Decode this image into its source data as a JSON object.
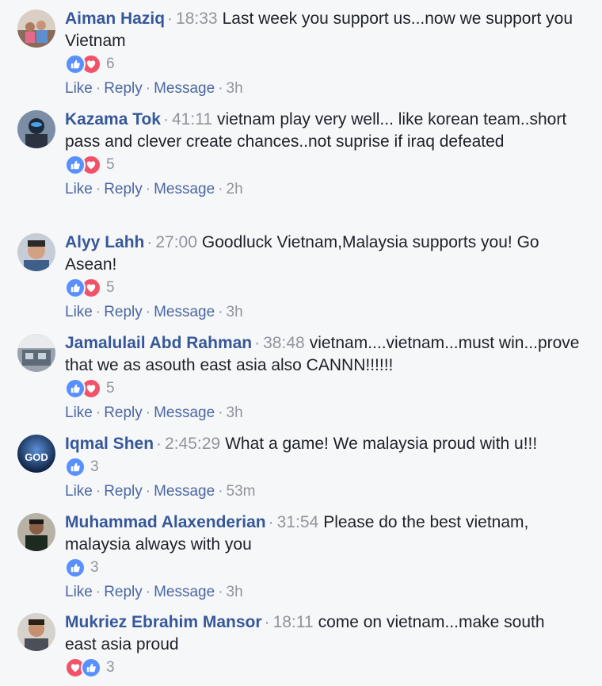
{
  "actions": {
    "like": "Like",
    "reply": "Reply",
    "message": "Message"
  },
  "colors": {
    "link": "#365899",
    "meta": "#90949c",
    "like": "#5890ff",
    "love": "#f25268",
    "background": "#f6f7f9"
  },
  "comments": [
    {
      "author": "Aiman Haziq",
      "timestamp": "18:33",
      "text": "Last week you support us...now we support you Vietnam",
      "reactions": [
        "like-icon",
        "love-icon"
      ],
      "count": "6",
      "age": "3h"
    },
    {
      "author": "Kazama Tok",
      "timestamp": "41:11",
      "text": "vietnam play very well... like korean team..short pass and clever create chances..not suprise if iraq defeated",
      "reactions": [
        "like-icon",
        "love-icon"
      ],
      "count": "5",
      "age": "2h"
    },
    {
      "author": "Alyy Lahh",
      "timestamp": "27:00",
      "text": "Goodluck Vietnam,Malaysia supports you! Go Asean!",
      "reactions": [
        "like-icon",
        "love-icon"
      ],
      "count": "5",
      "age": "3h"
    },
    {
      "author": "Jamalulail Abd Rahman",
      "timestamp": "38:48",
      "text": "vietnam....vietnam...must win...prove that we as asouth east asia also CANNN!!!!!!",
      "reactions": [
        "like-icon",
        "love-icon"
      ],
      "count": "5",
      "age": "3h"
    },
    {
      "author": "Iqmal Shen",
      "timestamp": "2:45:29",
      "text": "What a game! We malaysia proud with u!!!",
      "reactions": [
        "like-icon"
      ],
      "count": "3",
      "age": "53m",
      "avatar_text": "GOD"
    },
    {
      "author": "Muhammad Alaxenderian",
      "timestamp": "31:54",
      "text": "Please do the best vietnam, malaysia always with you",
      "reactions": [
        "like-icon"
      ],
      "count": "3",
      "age": "3h"
    },
    {
      "author": "Mukriez Ebrahim Mansor",
      "timestamp": "18:11",
      "text": "come on vietnam...make south east asia proud",
      "reactions": [
        "love-icon",
        "like-icon"
      ],
      "count": "3"
    }
  ]
}
